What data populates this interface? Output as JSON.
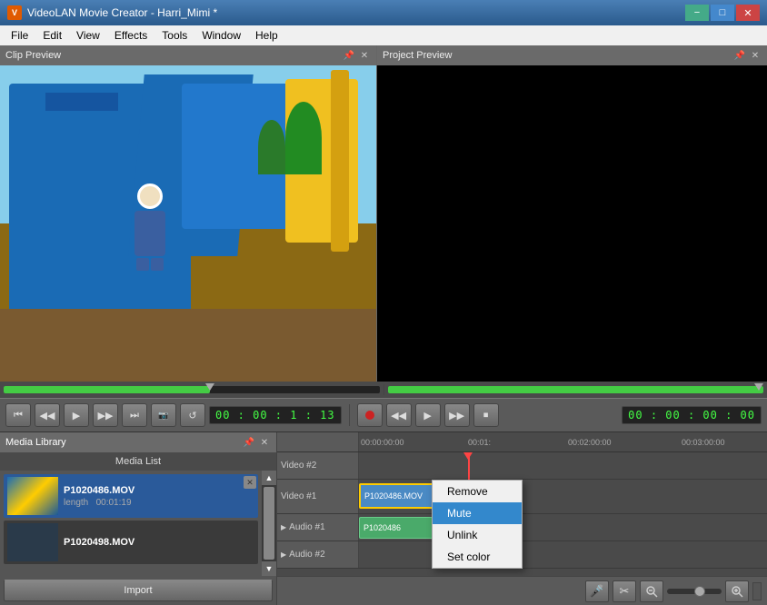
{
  "titleBar": {
    "title": "VideoLAN Movie Creator - Harri_Mimi *",
    "icon": "V",
    "controls": {
      "minimize": "−",
      "maximize": "□",
      "close": "✕"
    }
  },
  "menuBar": {
    "items": [
      "File",
      "Edit",
      "View",
      "Effects",
      "Tools",
      "Window",
      "Help"
    ]
  },
  "clipPreview": {
    "label": "Clip Preview",
    "pinLabel": "📌",
    "closeLabel": "✕"
  },
  "projectPreview": {
    "label": "Project Preview",
    "pinLabel": "📌",
    "closeLabel": "✕"
  },
  "controls": {
    "rewindLabel": "⏮",
    "backStepLabel": "◀◀",
    "playLabel": "▶",
    "forwardStepLabel": "▶▶",
    "fastForwardLabel": "⏭",
    "snapshotLabel": "📷",
    "loopLabel": "↺",
    "timeDisplay": "00 : 00 : 1 : 13",
    "timeDisplay2": "00 : 00 : 00 : 00",
    "recordLabel": "●",
    "playLabel2": "▶",
    "backLabel2": "◀◀",
    "forwardLabel2": "▶▶",
    "stopLabel2": "⏹"
  },
  "mediaLibrary": {
    "label": "Media Library",
    "pinLabel": "📌",
    "closeLabel": "✕",
    "listLabel": "Media List",
    "items": [
      {
        "name": "P1020486.MOV",
        "lengthLabel": "length",
        "length": "00:01:19"
      },
      {
        "name": "P1020498.MOV"
      }
    ],
    "importLabel": "Import"
  },
  "timeline": {
    "rulers": [
      "00:00:00:00",
      "00:01:",
      "00:02:00:00",
      "00:03:00:00"
    ],
    "tracks": [
      {
        "id": "video2",
        "label": "Video #2",
        "hasArrow": false,
        "clip": null
      },
      {
        "id": "video1",
        "label": "Video #1",
        "hasArrow": false,
        "clip": {
          "name": "P1020486.MOV",
          "left": 0,
          "width": 155,
          "selected": true
        }
      },
      {
        "id": "audio1",
        "label": "Audio #1",
        "hasArrow": true,
        "clip": {
          "name": "P1020486",
          "left": 0,
          "width": 120,
          "type": "audio"
        }
      },
      {
        "id": "audio2",
        "label": "Audio #2",
        "hasArrow": true,
        "clip": null
      }
    ]
  },
  "contextMenu": {
    "items": [
      {
        "label": "Remove",
        "hovered": false
      },
      {
        "label": "Mute",
        "hovered": true
      },
      {
        "label": "Unlink",
        "hovered": false
      },
      {
        "label": "Set color",
        "hovered": false
      }
    ]
  },
  "timelineControls": {
    "micLabel": "🎤",
    "scissorsLabel": "✂",
    "zoomInLabel": "🔍+",
    "zoomOutLabel": "🔍-"
  }
}
